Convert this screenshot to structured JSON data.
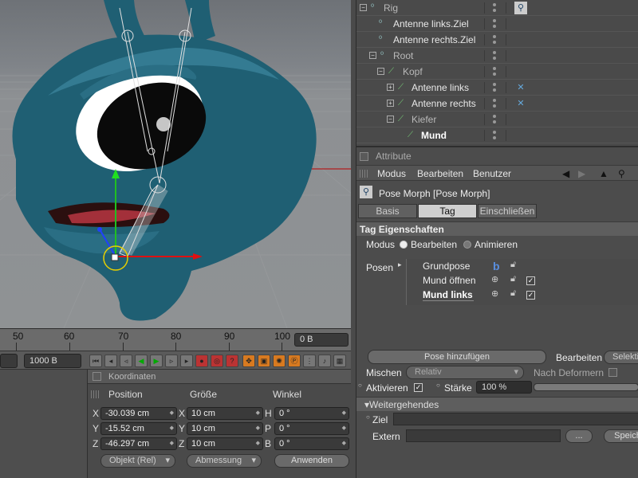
{
  "viewport": {
    "colors": {
      "skin": "#1f5f73",
      "skin_light": "#3d87a0",
      "floor": "#8e9194"
    }
  },
  "timeline": {
    "ticks": [
      "50",
      "60",
      "70",
      "80",
      "90",
      "100"
    ],
    "current_frame": "0 B"
  },
  "transport": {
    "end_frame": "1000 B"
  },
  "object_manager": {
    "rows": [
      {
        "name": "Rig",
        "style": "dim"
      },
      {
        "name": "Antenne links.Ziel",
        "style": "normal"
      },
      {
        "name": "Antenne rechts.Ziel",
        "style": "normal"
      },
      {
        "name": "Root",
        "style": "dim"
      },
      {
        "name": "Kopf",
        "style": "dim"
      },
      {
        "name": "Antenne links",
        "style": "normal"
      },
      {
        "name": "Antenne rechts",
        "style": "normal"
      },
      {
        "name": "Kiefer",
        "style": "dim"
      },
      {
        "name": "Mund",
        "style": "selected"
      }
    ]
  },
  "attributes": {
    "title": "Attribute",
    "menu": [
      "Modus",
      "Bearbeiten",
      "Benutzer"
    ],
    "object_label": "Pose Morph [Pose Morph]",
    "tabs": [
      "Basis",
      "Tag",
      "Einschließen"
    ],
    "active_tab": "Tag",
    "section_tag": "Tag Eigenschaften",
    "modus_label": "Modus",
    "modus_options": [
      "Bearbeiten",
      "Animieren"
    ],
    "posen_label": "Posen",
    "poses": [
      "Grundpose",
      "Mund öffnen",
      "Mund links"
    ],
    "add_pose_label": "Pose hinzufügen",
    "edit_label": "Bearbeiten",
    "edit_value": "Selekti",
    "mix_label": "Mischen",
    "mix_value": "Relativ",
    "after_deformers_label": "Nach Deformern",
    "activate_label": "Aktivieren",
    "strength_label": "Stärke",
    "strength_value": "100 %",
    "strength": 1.0,
    "section_advanced": "Weitergehendes",
    "target_label": "Ziel",
    "extern_label": "Extern",
    "browse_label": "...",
    "save_label": "Speich"
  },
  "coordinates": {
    "title": "Koordinaten",
    "headers": [
      "Position",
      "Größe",
      "Winkel"
    ],
    "rows": [
      {
        "axis": "X",
        "pos": "-30.039 cm",
        "size_axis": "X",
        "size": "10 cm",
        "rot_axis": "H",
        "rot": "0 °"
      },
      {
        "axis": "Y",
        "pos": "-15.52 cm",
        "size_axis": "Y",
        "size": "10 cm",
        "rot_axis": "P",
        "rot": "0 °"
      },
      {
        "axis": "Z",
        "pos": "-46.297 cm",
        "size_axis": "Z",
        "size": "10 cm",
        "rot_axis": "B",
        "rot": "0 °"
      }
    ],
    "mode_value": "Objekt (Rel)",
    "size_mode_value": "Abmessung",
    "apply_label": "Anwenden"
  }
}
